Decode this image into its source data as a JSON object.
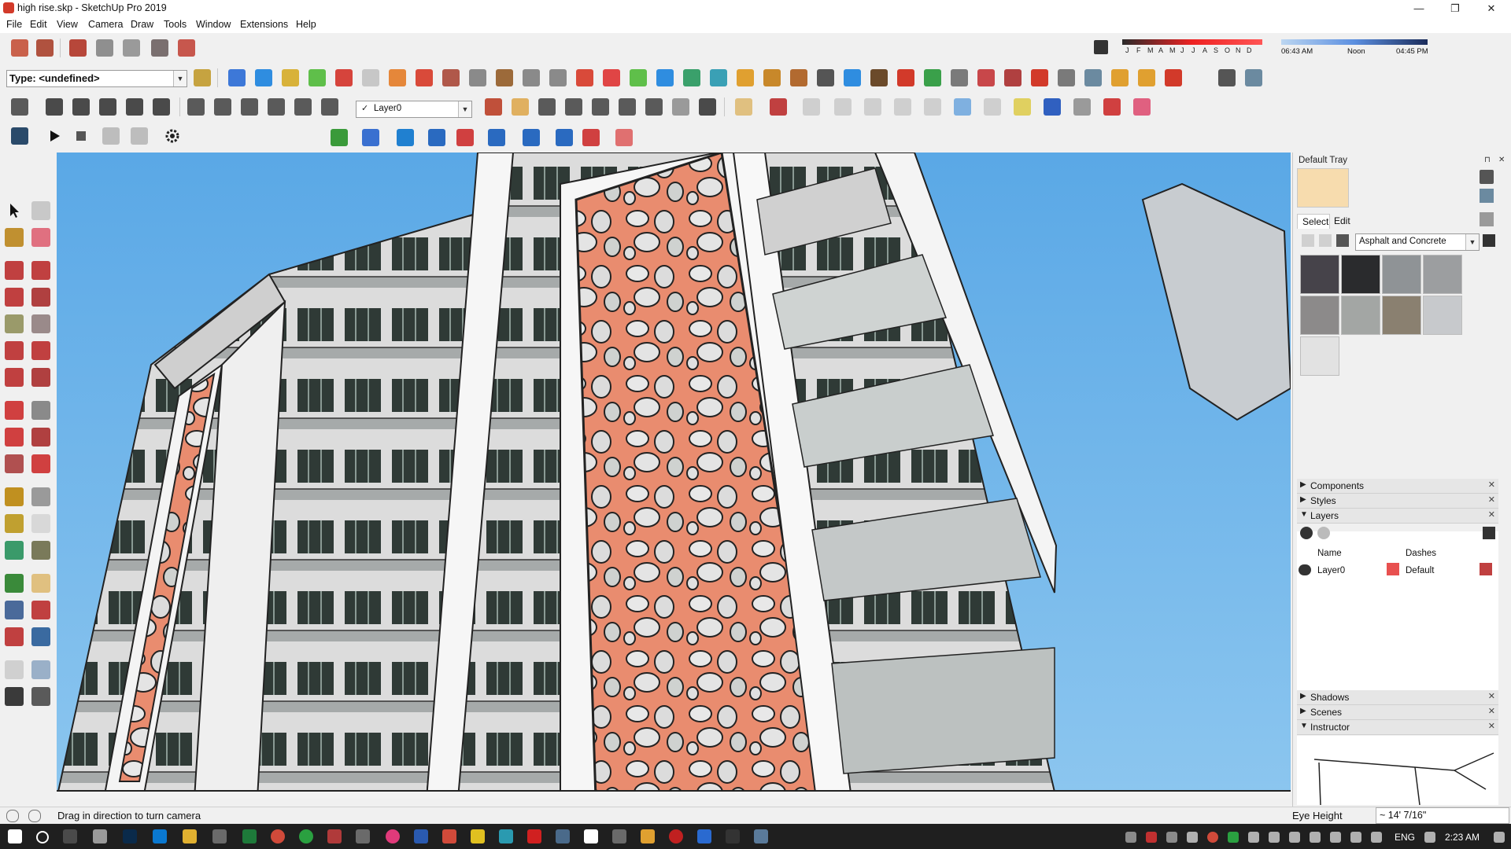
{
  "window": {
    "title": "high rise.skp - SketchUp Pro 2019",
    "minimize_glyph": "—",
    "restore_glyph": "❐",
    "close_glyph": "✕"
  },
  "menu": [
    "File",
    "Edit",
    "View",
    "Camera",
    "Draw",
    "Tools",
    "Window",
    "Extensions",
    "Help"
  ],
  "toolbar": {
    "type_label": "Type: <undefined>",
    "layer_value": "Layer0",
    "layer_check": "✓",
    "combo_arrow": "▼"
  },
  "shadows": {
    "months": [
      "J",
      "F",
      "M",
      "A",
      "M",
      "J",
      "J",
      "A",
      "S",
      "O",
      "N",
      "D"
    ],
    "time_start": "06:43 AM",
    "time_mid": "Noon",
    "time_end": "04:45 PM"
  },
  "tray": {
    "title": "Default Tray",
    "pin_glyph": "⊓",
    "close_glyph": "✕",
    "materials": {
      "tab_select": "Select",
      "tab_edit": "Edit",
      "library": "Asphalt and Concrete",
      "swatch_colors": [
        "#46434a",
        "#2a2b2d",
        "#8f9396",
        "#9c9ea0",
        "#8c8a8a",
        "#a3a6a4",
        "#8a8070",
        "#c7c9cc",
        "#e2e2e2"
      ]
    },
    "panels": {
      "components": "Components",
      "styles": "Styles",
      "layers": "Layers",
      "shadows": "Shadows",
      "scenes": "Scenes",
      "instructor": "Instructor"
    },
    "layers_table": {
      "col_name": "Name",
      "col_dashes": "Dashes",
      "row_name": "Layer0",
      "row_dashes": "Default",
      "row_color": "#e8504f"
    }
  },
  "status": {
    "hint": "Drag in direction to turn camera",
    "vcb_label": "Eye Height",
    "vcb_value": "~ 14' 7/16\""
  },
  "taskbar": {
    "lang": "ENG",
    "clock": "2:23 AM"
  },
  "colors": {
    "sky": "#6db2e6",
    "panel_orange": "#e98c6f",
    "facade": "#e4e4e4"
  }
}
